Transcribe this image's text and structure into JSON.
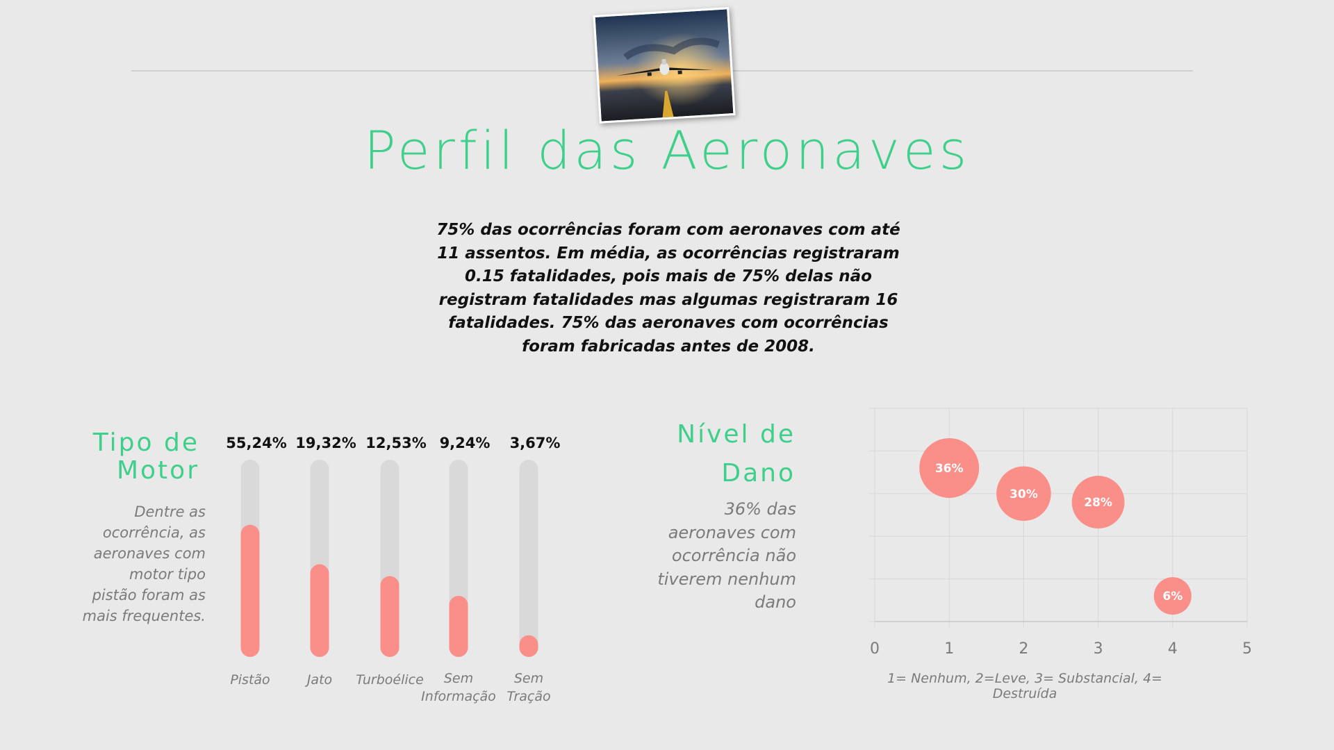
{
  "slide": {
    "title": "Perfil das Aeronaves",
    "summary": "75% das ocorrências foram com aeronaves com até 11 assentos. Em média, as ocorrências registraram 0.15 fatalidades, pois mais de 75% delas não registram fatalidades mas algumas registraram 16 fatalidades. 75% das aeronaves com ocorrências foram fabricadas antes de 2008."
  },
  "engine_section": {
    "heading": "Tipo de Motor",
    "note": "Dentre as ocorrência, as aeronaves com motor tipo pistão foram as mais frequentes."
  },
  "damage_section": {
    "heading": "Nível de Dano",
    "note": "36% das aeronaves com ocorrência não tiverem nenhum dano",
    "axis_caption": "1= Nenhum, 2=Leve, 3= Substancial, 4= Destruída"
  },
  "colors": {
    "accent_green": "#3ecf8a",
    "bar_fill": "#f98f88",
    "bar_track": "#d9d9d9",
    "bubble": "#f98f88"
  },
  "chart_data": [
    {
      "type": "bar",
      "categories": [
        "Pistão",
        "Jato",
        "Turboélice",
        "Sem Informação",
        "Sem Tração"
      ],
      "values": [
        55.24,
        19.32,
        12.53,
        9.24,
        3.67
      ],
      "value_labels": [
        "55,24%",
        "19,32%",
        "12,53%",
        "9,24%",
        "3,67%"
      ],
      "fill_fraction": [
        0.67,
        0.47,
        0.41,
        0.31,
        0.11
      ],
      "orientation": "vertical",
      "grid": false
    },
    {
      "type": "scatter",
      "bubbles": true,
      "x": [
        1,
        2,
        3,
        4
      ],
      "y": [
        3.6,
        3.0,
        2.8,
        0.6
      ],
      "values": [
        36,
        30,
        28,
        6
      ],
      "labels": [
        "36%",
        "30%",
        "28%",
        "6%"
      ],
      "xlim": [
        0,
        5
      ],
      "ylim": [
        0,
        5
      ],
      "xticks": [
        "0",
        "1",
        "2",
        "3",
        "4",
        "5"
      ],
      "grid": true
    }
  ]
}
